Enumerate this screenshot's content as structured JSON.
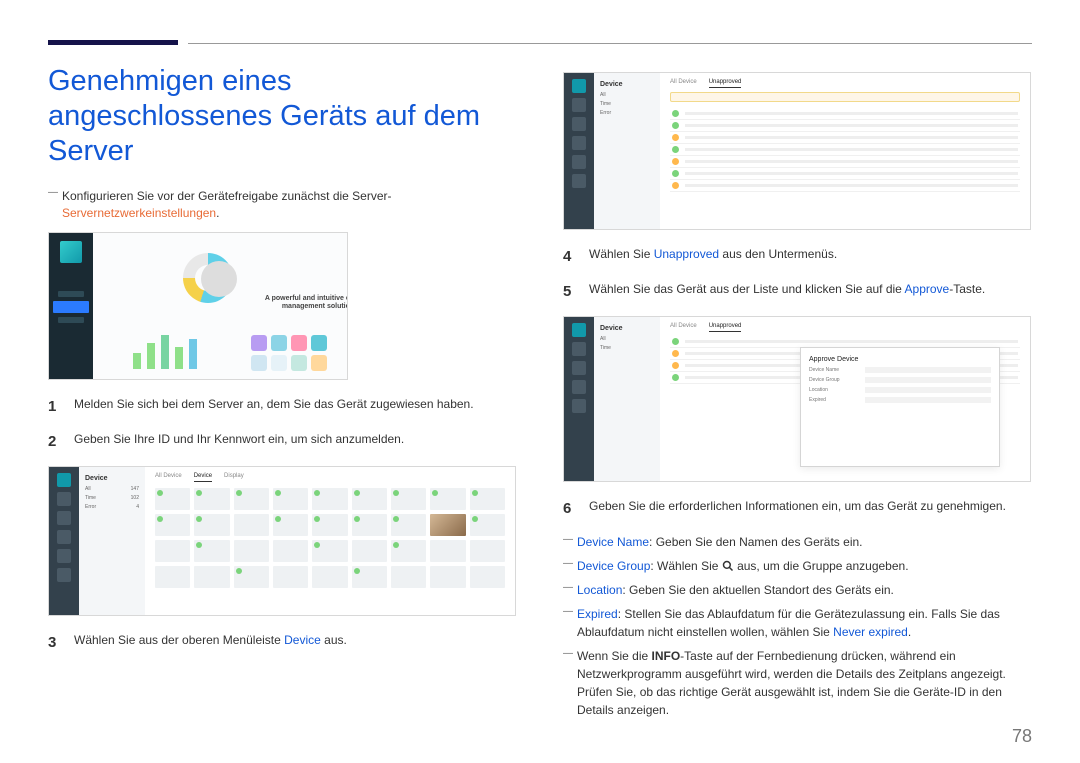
{
  "page_number": "78",
  "title": "Genehmigen eines angeschlossenes Geräts auf dem Server",
  "note": {
    "prefix": "Konfigurieren Sie vor der Gerätefreigabe zunächst die Server-",
    "link": "Servernetzwerkeinstellungen",
    "suffix": "."
  },
  "steps": {
    "s1": "Melden Sie sich bei dem Server an, dem Sie das Gerät zugewiesen haben.",
    "s2": "Geben Sie Ihre ID und Ihr Kennwort ein, um sich anzumelden.",
    "s3_pre": "Wählen Sie aus der oberen Menüleiste ",
    "s3_term": "Device",
    "s3_post": " aus.",
    "s4_pre": "Wählen Sie ",
    "s4_term": "Unapproved",
    "s4_post": " aus den Untermenüs.",
    "s5_pre": "Wählen Sie das Gerät aus der Liste und klicken Sie auf die ",
    "s5_term": "Approve",
    "s5_post": "-Taste.",
    "s6": "Geben Sie die erforderlichen Informationen ein, um das Gerät zu genehmigen."
  },
  "bullets": {
    "b1_term": "Device Name",
    "b1_text": ": Geben Sie den Namen des Geräts ein.",
    "b2_term": "Device Group",
    "b2_pre": ": Wählen Sie ",
    "b2_post": " aus, um die Gruppe anzugeben.",
    "b3_term": "Location",
    "b3_text": ": Geben Sie den aktuellen Standort des Geräts ein.",
    "b4_term": "Expired",
    "b4_text_a": ": Stellen Sie das Ablaufdatum für die Gerätezulassung ein. Falls Sie das Ablaufdatum nicht einstellen wollen, wählen Sie ",
    "b4_link": "Never expired",
    "b4_text_b": ".",
    "b5_pre": "Wenn Sie die ",
    "b5_bold": "INFO",
    "b5_post": "-Taste auf der Fernbedienung drücken, während ein Netzwerkprogramm ausgeführt wird, werden die Details des Zeitplans angezeigt. Prüfen Sie, ob das richtige Gerät ausgewählt ist, indem Sie die Geräte-ID in den Details anzeigen."
  },
  "ss": {
    "label_device": "Device",
    "caption": "A powerful and intuitive content management solution",
    "modal_title": "Approve Device",
    "tab_device": "Device"
  }
}
